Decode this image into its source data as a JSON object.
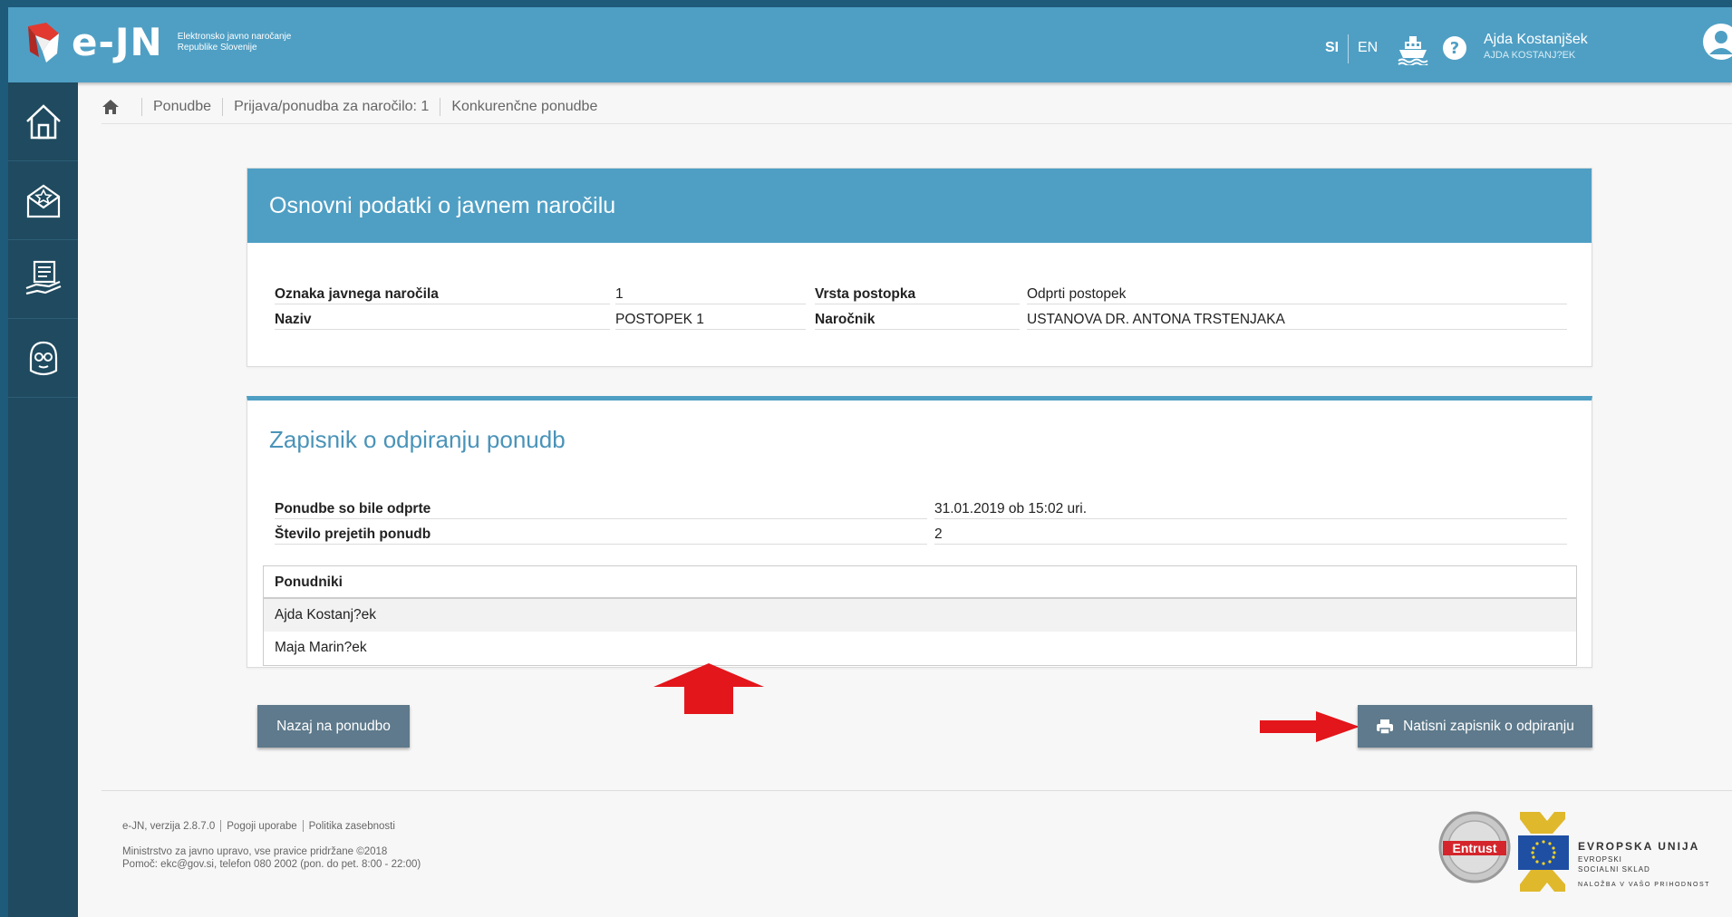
{
  "header": {
    "app_name": "e-JN",
    "app_subtitle_1": "Elektronsko javno naročanje",
    "app_subtitle_2": "Republike Slovenije",
    "lang_si": "SI",
    "lang_en": "EN",
    "user_name": "Ajda Kostanjšek",
    "user_sub": "AJDA KOSTANJ?EK"
  },
  "sidebar": {
    "items": [
      {
        "icon": "home-icon"
      },
      {
        "icon": "envelope-star-icon"
      },
      {
        "icon": "hand-document-icon"
      },
      {
        "icon": "support-person-icon"
      }
    ]
  },
  "breadcrumb": {
    "items": [
      "Ponudbe",
      "Prijava/ponudba za naročilo: 1",
      "Konkurenčne ponudbe"
    ]
  },
  "basic_info": {
    "title": "Osnovni podatki o javnem naročilu",
    "rows": [
      {
        "label1": "Oznaka javnega naročila",
        "value1": "1",
        "label2": "Vrsta postopka",
        "value2": "Odprti postopek"
      },
      {
        "label1": "Naziv",
        "value1": "POSTOPEK 1",
        "label2": "Naročnik",
        "value2": "USTANOVA DR. ANTONA TRSTENJAKA"
      }
    ]
  },
  "opening": {
    "title": "Zapisnik o odpiranju ponudb",
    "rows": [
      {
        "label": "Ponudbe so bile odprte",
        "value": "31.01.2019 ob 15:02 uri."
      },
      {
        "label": "Število prejetih ponudb",
        "value": "2"
      }
    ],
    "bidders_header": "Ponudniki",
    "bidders": [
      "Ajda Kostanj?ek",
      "Maja Marin?ek"
    ]
  },
  "buttons": {
    "back": "Nazaj na ponudbo",
    "print": "Natisni zapisnik o odpiranju"
  },
  "footer": {
    "version": "e-JN, verzija 2.8.7.0",
    "terms": "Pogoji uporabe",
    "privacy": "Politika zasebnosti",
    "copyright": "Ministrstvo za javno upravo, vse pravice pridržane ©2018",
    "help": "Pomoč: ekc@gov.si, telefon 080 2002 (pon. do pet. 8:00 - 22:00)",
    "eu_line1": "EVROPSKA UNIJA",
    "eu_line2": "EVROPSKI",
    "eu_line3": "SOCIALNI SKLAD",
    "eu_line4": "NALOŽBA V VAŠO PRIHODNOST",
    "entrust": "Entrust"
  },
  "colors": {
    "header": "#4f9fc4",
    "sidebar": "#1f4a5f",
    "button": "#5e7a8c",
    "annotation_arrow": "#e3161b"
  }
}
